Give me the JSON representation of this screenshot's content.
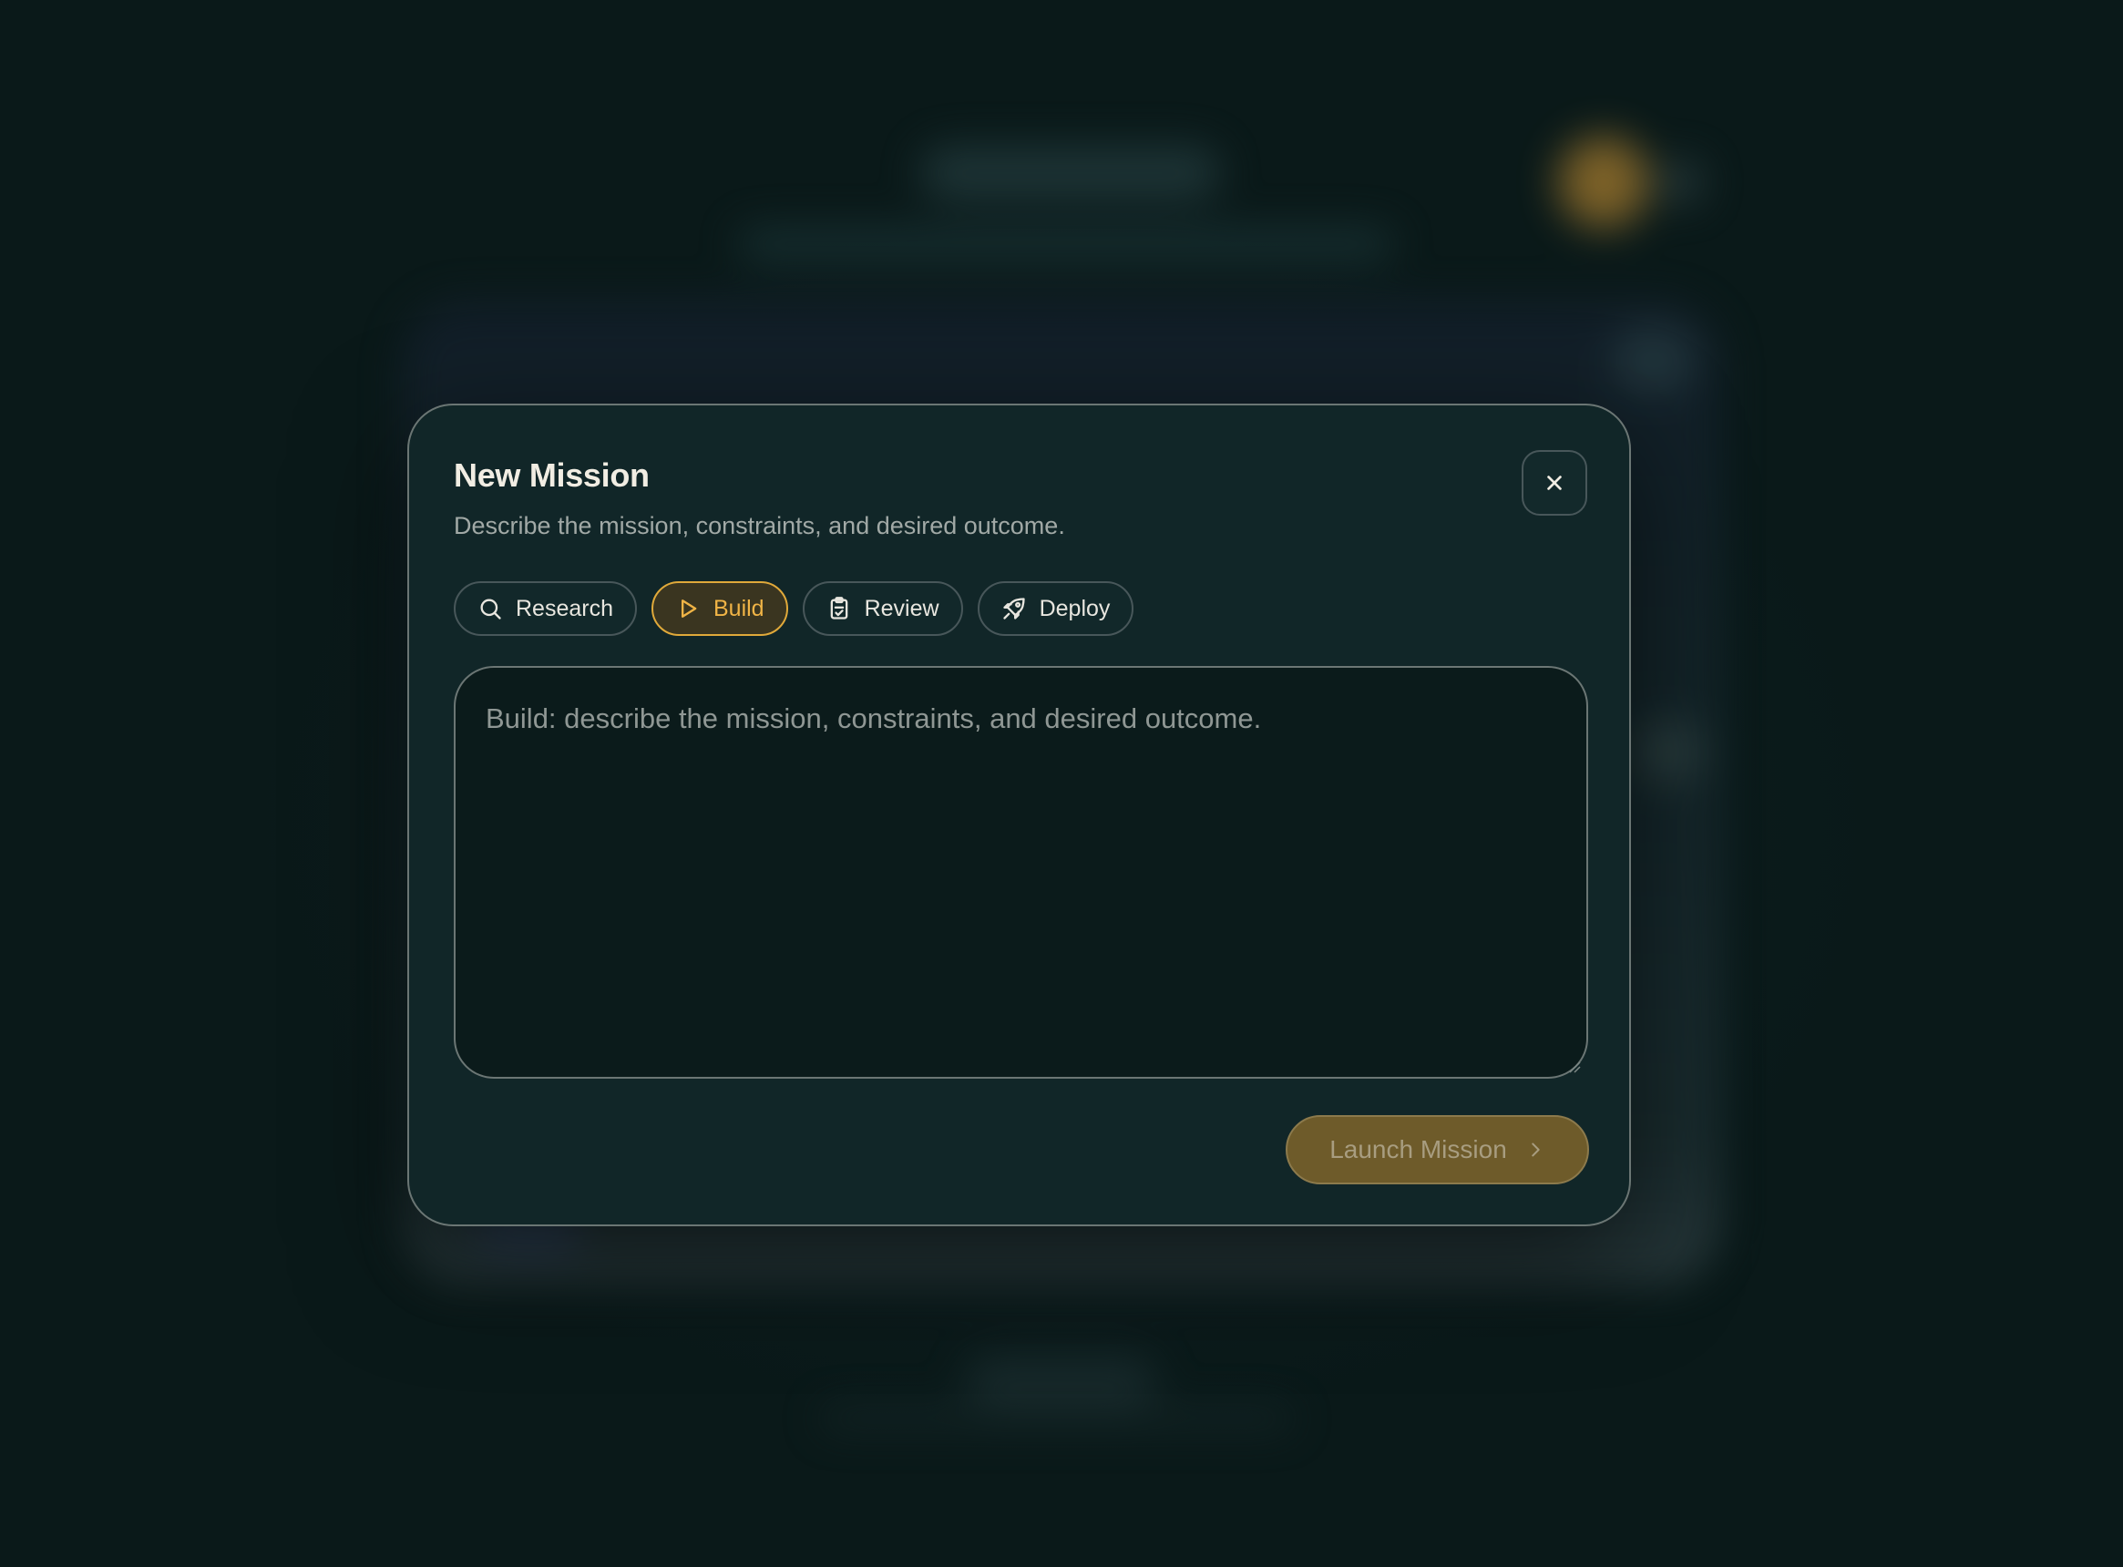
{
  "modal": {
    "title": "New Mission",
    "subtitle": "Describe the mission, constraints, and desired outcome.",
    "close_icon": "close-icon"
  },
  "tabs": [
    {
      "label": "Research",
      "icon": "search-icon",
      "active": false
    },
    {
      "label": "Build",
      "icon": "play-icon",
      "active": true
    },
    {
      "label": "Review",
      "icon": "clipboard-check-icon",
      "active": false
    },
    {
      "label": "Deploy",
      "icon": "rocket-icon",
      "active": false
    }
  ],
  "mission_input": {
    "value": "",
    "placeholder": "Build: describe the mission, constraints, and desired outcome."
  },
  "launch": {
    "label": "Launch Mission",
    "icon": "chevron-right-icon"
  },
  "colors": {
    "accent": "#e0a93a",
    "modal_bg": "#112628",
    "page_bg": "#0b1a1b"
  }
}
